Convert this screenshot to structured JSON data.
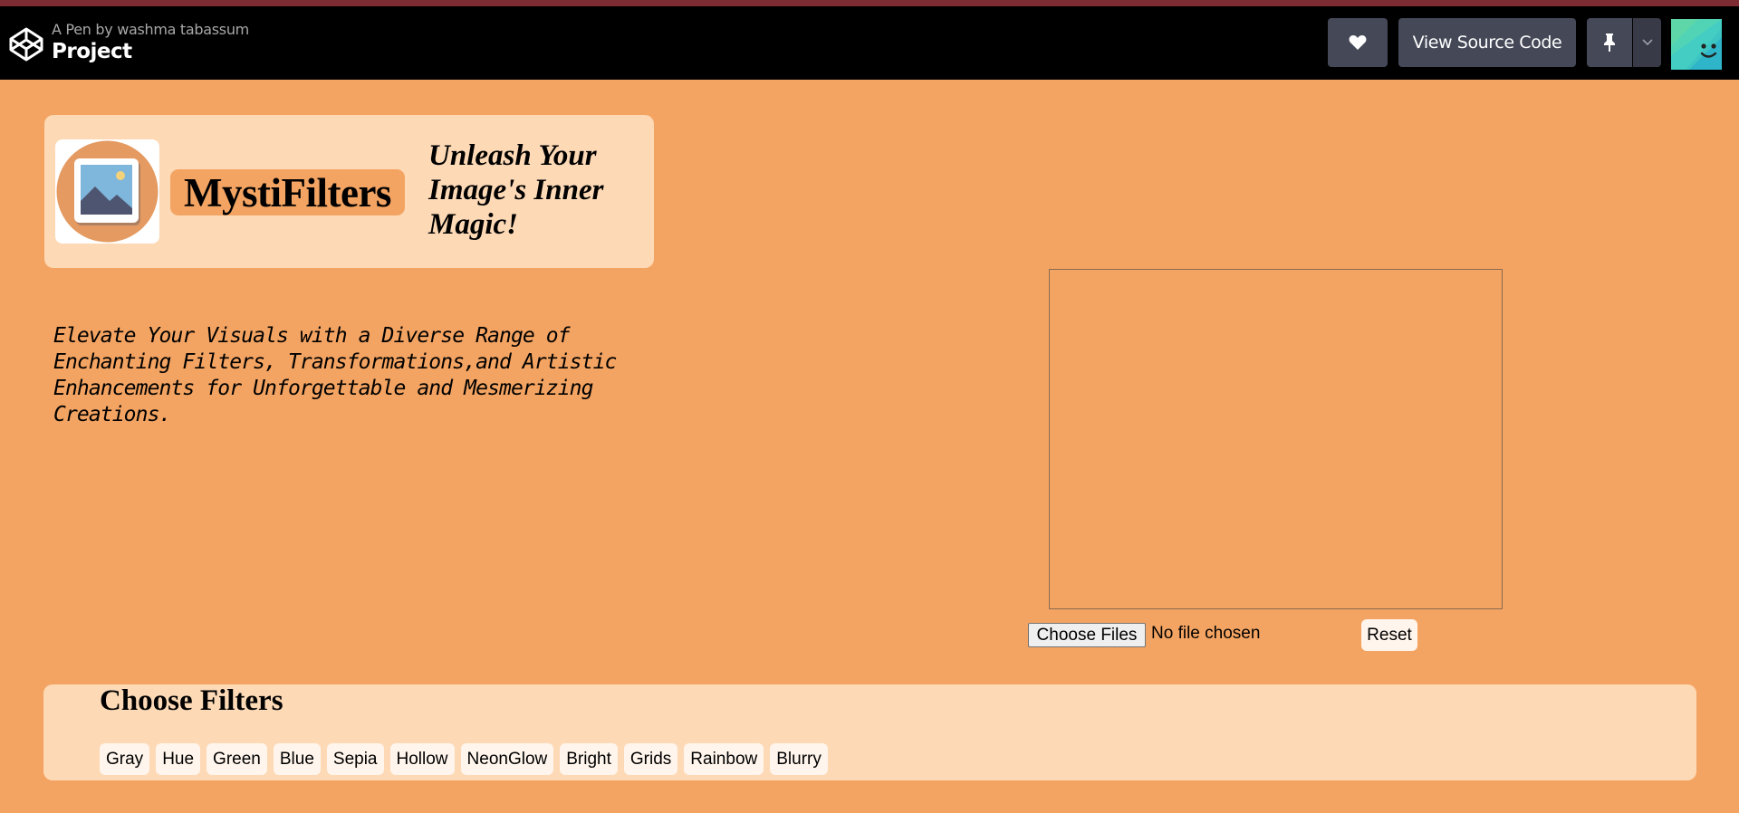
{
  "header": {
    "pen_by": "A Pen by washma tabassum",
    "title": "Project",
    "source_button": "View Source Code"
  },
  "brand": {
    "name": "MystiFilters",
    "tagline": "Unleash Your Image's Inner Magic!"
  },
  "description": "Elevate Your Visuals with a Diverse Range of Enchanting Filters, Transformations,and Artistic Enhancements for Unforgettable and Mesmerizing Creations.",
  "upload": {
    "choose_label": "Choose Files",
    "status": "No file chosen",
    "reset_label": "Reset"
  },
  "filters": {
    "title": "Choose Filters",
    "items": [
      "Gray",
      "Hue",
      "Green",
      "Blue",
      "Sepia",
      "Hollow",
      "NeonGlow",
      "Bright",
      "Grids",
      "Rainbow",
      "Blurry"
    ]
  },
  "colors": {
    "page_bg": "#f4a462",
    "card_bg": "#fdd9b6",
    "header_bg": "#000000",
    "button_bg": "#444857"
  }
}
